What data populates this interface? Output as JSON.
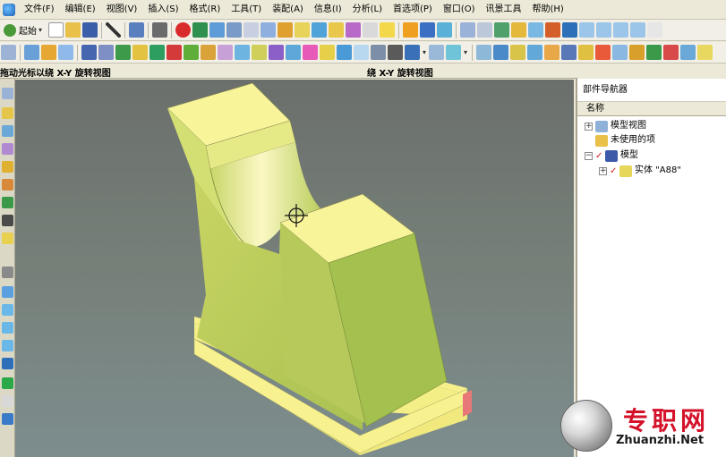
{
  "menu": {
    "items": [
      {
        "label": "文件(F)"
      },
      {
        "label": "编辑(E)"
      },
      {
        "label": "视图(V)"
      },
      {
        "label": "插入(S)"
      },
      {
        "label": "格式(R)"
      },
      {
        "label": "工具(T)"
      },
      {
        "label": "装配(A)"
      },
      {
        "label": "信息(I)"
      },
      {
        "label": "分析(L)"
      },
      {
        "label": "首选项(P)"
      },
      {
        "label": "窗口(O)"
      },
      {
        "label": "讯景工具"
      },
      {
        "label": "帮助(H)"
      }
    ]
  },
  "toolbar": {
    "start_label": "起始",
    "dropdown_glyph": "▾"
  },
  "status": {
    "left_text": "拖动光标以绕 X-Y 旋转视图",
    "center_text": "绕 X-Y 旋转视图"
  },
  "navigator": {
    "title": "部件导航器",
    "column_name": "名称",
    "nodes": [
      {
        "label": "模型视图",
        "expander": "+"
      },
      {
        "label": "未使用的项",
        "expander": ""
      },
      {
        "label": "模型",
        "expander": "−"
      },
      {
        "label": "实体 \"A88\"",
        "expander": "+"
      }
    ]
  },
  "watermark": {
    "cn_text": "专职网",
    "en_text": "Zhuanzhi.Net"
  },
  "colors": {
    "part_light": "#f7f29a",
    "part_mid": "#d6e07a",
    "part_dark": "#9fbf4f",
    "accent_red": "#d4122a"
  }
}
